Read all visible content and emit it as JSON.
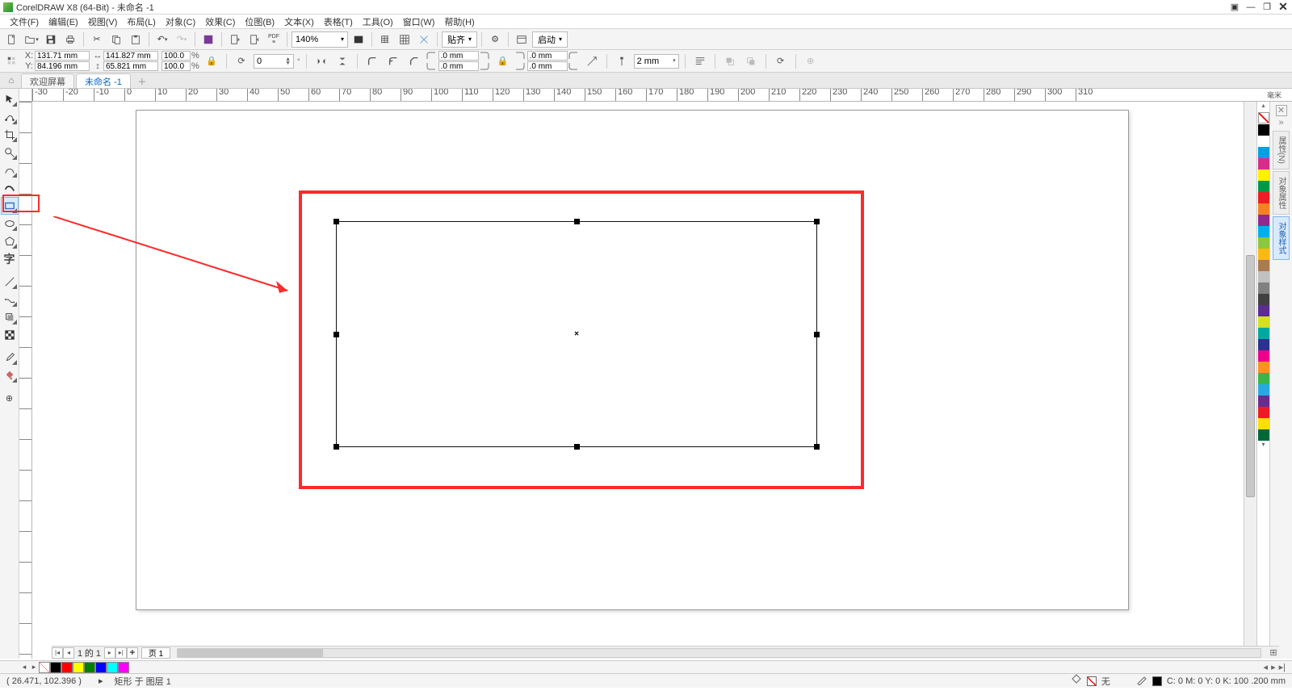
{
  "titlebar": {
    "app": "CorelDRAW X8 (64-Bit) - 未命名 -1"
  },
  "menu": [
    "文件(F)",
    "编辑(E)",
    "视图(V)",
    "布局(L)",
    "对象(C)",
    "效果(C)",
    "位图(B)",
    "文本(X)",
    "表格(T)",
    "工具(O)",
    "窗口(W)",
    "帮助(H)"
  ],
  "toolbar1": {
    "zoom": "140%",
    "snap_label": "贴齐",
    "launch_label": "启动"
  },
  "propbar": {
    "x": "131.71 mm",
    "y": "84.196 mm",
    "w": "141.827 mm",
    "h": "65.821 mm",
    "sx": "100.0",
    "sy": "100.0",
    "rotate": "0",
    "corner_tl": ".0 mm",
    "corner_tr": ".0 mm",
    "corner_bl": ".0 mm",
    "corner_br": ".0 mm",
    "outline_w": "2 mm"
  },
  "tabs": {
    "welcome": "欢迎屏幕",
    "doc": "未命名 -1"
  },
  "ruler_h": [
    -30,
    -20,
    -10,
    0,
    10,
    20,
    30,
    40,
    50,
    60,
    70,
    80,
    90,
    100,
    110,
    120,
    130,
    140,
    150,
    160,
    170,
    180,
    190,
    200,
    210,
    220,
    230,
    240,
    250,
    260,
    270,
    280,
    290,
    300,
    310
  ],
  "ruler_h_unit": "毫米",
  "page_nav": {
    "current": "1",
    "total": "1",
    "of": "的",
    "page_tab": "页 1"
  },
  "palette": [
    "#000000",
    "#ffffff",
    "#00a0e3",
    "#d62e88",
    "#fff200",
    "#009846",
    "#ee1d23",
    "#f58220",
    "#92278f",
    "#00aeef",
    "#8dc63f",
    "#fdb913",
    "#a97c50",
    "#c0c0c0",
    "#808080",
    "#404040",
    "#5b2d90",
    "#d7df23",
    "#00a99d",
    "#2e3192",
    "#ec008c",
    "#f7941d",
    "#39b54a",
    "#27aae1",
    "#662d91",
    "#ed1c24",
    "#ffde00",
    "#006838"
  ],
  "bottom_palette": [
    "#000000",
    "#ff0000",
    "#ffff00",
    "#008000",
    "#0000ff",
    "#00ffff",
    "#ff00ff"
  ],
  "status": {
    "coords": "( 26.471, 102.396 )",
    "cursor_hint": "▸",
    "object": "矩形 于 图层 1",
    "fill_none_label": "无",
    "outline_info": "C: 0 M: 0 Y: 0 K: 100  .200 mm"
  },
  "dockers": [
    "属性(N)",
    "对象属性",
    "对象样式"
  ]
}
